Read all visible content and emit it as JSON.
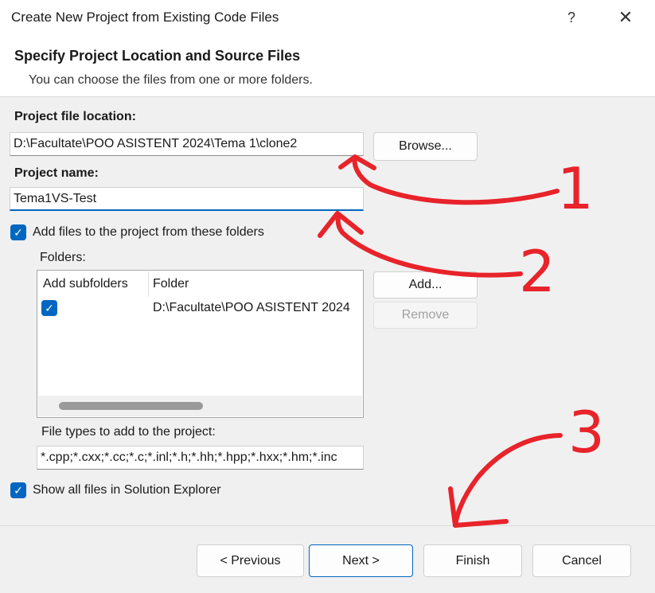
{
  "window": {
    "title": "Create New Project from Existing Code Files",
    "help_label": "?",
    "close_label": "✕"
  },
  "header": {
    "title": "Specify Project Location and Source Files",
    "subtitle": "You can choose the files from one or more folders."
  },
  "form": {
    "location_label": "Project file location:",
    "location_value": "D:\\Facultate\\POO ASISTENT 2024\\Tema 1\\clone2",
    "browse_label": "Browse...",
    "name_label": "Project name:",
    "name_value": "Tema1VS-Test",
    "add_files_label": "Add files to the project from these folders",
    "add_files_checked": true,
    "folders_label": "Folders:",
    "folders_table": {
      "columns": [
        "Add subfolders",
        "Folder"
      ],
      "rows": [
        {
          "add_subfolders": true,
          "folder": "D:\\Facultate\\POO ASISTENT 2024"
        }
      ]
    },
    "add_label": "Add...",
    "remove_label": "Remove",
    "file_types_label": "File types to add to the project:",
    "file_types_value": "*.cpp;*.cxx;*.cc;*.c;*.inl;*.h;*.hh;*.hpp;*.hxx;*.hm;*.inc",
    "show_all_label": "Show all files in Solution Explorer",
    "show_all_checked": true
  },
  "footer": {
    "previous_label": "< Previous",
    "next_label": "Next >",
    "finish_label": "Finish",
    "cancel_label": "Cancel"
  },
  "annotations": {
    "numbers": [
      "1",
      "2",
      "3"
    ],
    "color": "#e8232a"
  },
  "colors": {
    "accent": "#0067c0",
    "content_bg": "#f0f0f0"
  },
  "icons": {
    "checkbox_checked": "checkmark-icon"
  }
}
